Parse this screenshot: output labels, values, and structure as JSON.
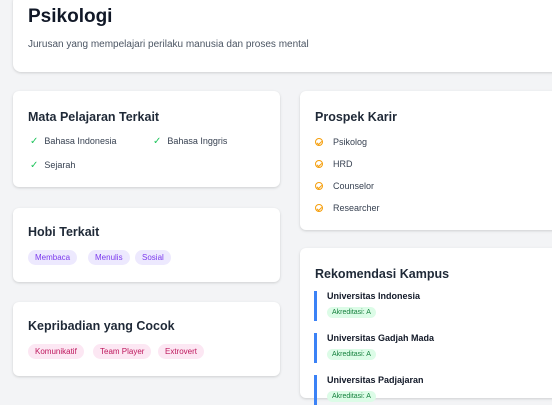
{
  "header": {
    "title": "Psikologi",
    "description": "Jurusan yang mempelajari perilaku manusia dan proses mental"
  },
  "subjects": {
    "title": "Mata Pelajaran Terkait",
    "items": [
      "Bahasa Indonesia",
      "Bahasa Inggris",
      "Sejarah"
    ],
    "check_color": "#22c55e"
  },
  "career": {
    "title": "Prospek Karir",
    "items": [
      "Psikolog",
      "HRD",
      "Counselor",
      "Researcher"
    ],
    "icon_color": "#f59e0b"
  },
  "hobbies": {
    "title": "Hobi Terkait",
    "tags": [
      "Membaca",
      "Menulis",
      "Sosial"
    ],
    "tag_color": "#7c3aed"
  },
  "personality": {
    "title": "Kepribadian yang Cocok",
    "tags": [
      "Komunikatif",
      "Team Player",
      "Extrovert"
    ],
    "tag_color": "#be185d"
  },
  "campus": {
    "title": "Rekomendasi Kampus",
    "universities": [
      {
        "name": "Universitas Indonesia",
        "accreditation": "Akreditasi: A"
      },
      {
        "name": "Universitas Gadjah Mada",
        "accreditation": "Akreditasi: A"
      },
      {
        "name": "Universitas Padjajaran",
        "accreditation": "Akreditasi: A"
      }
    ],
    "accent_color": "#3b82f6"
  }
}
